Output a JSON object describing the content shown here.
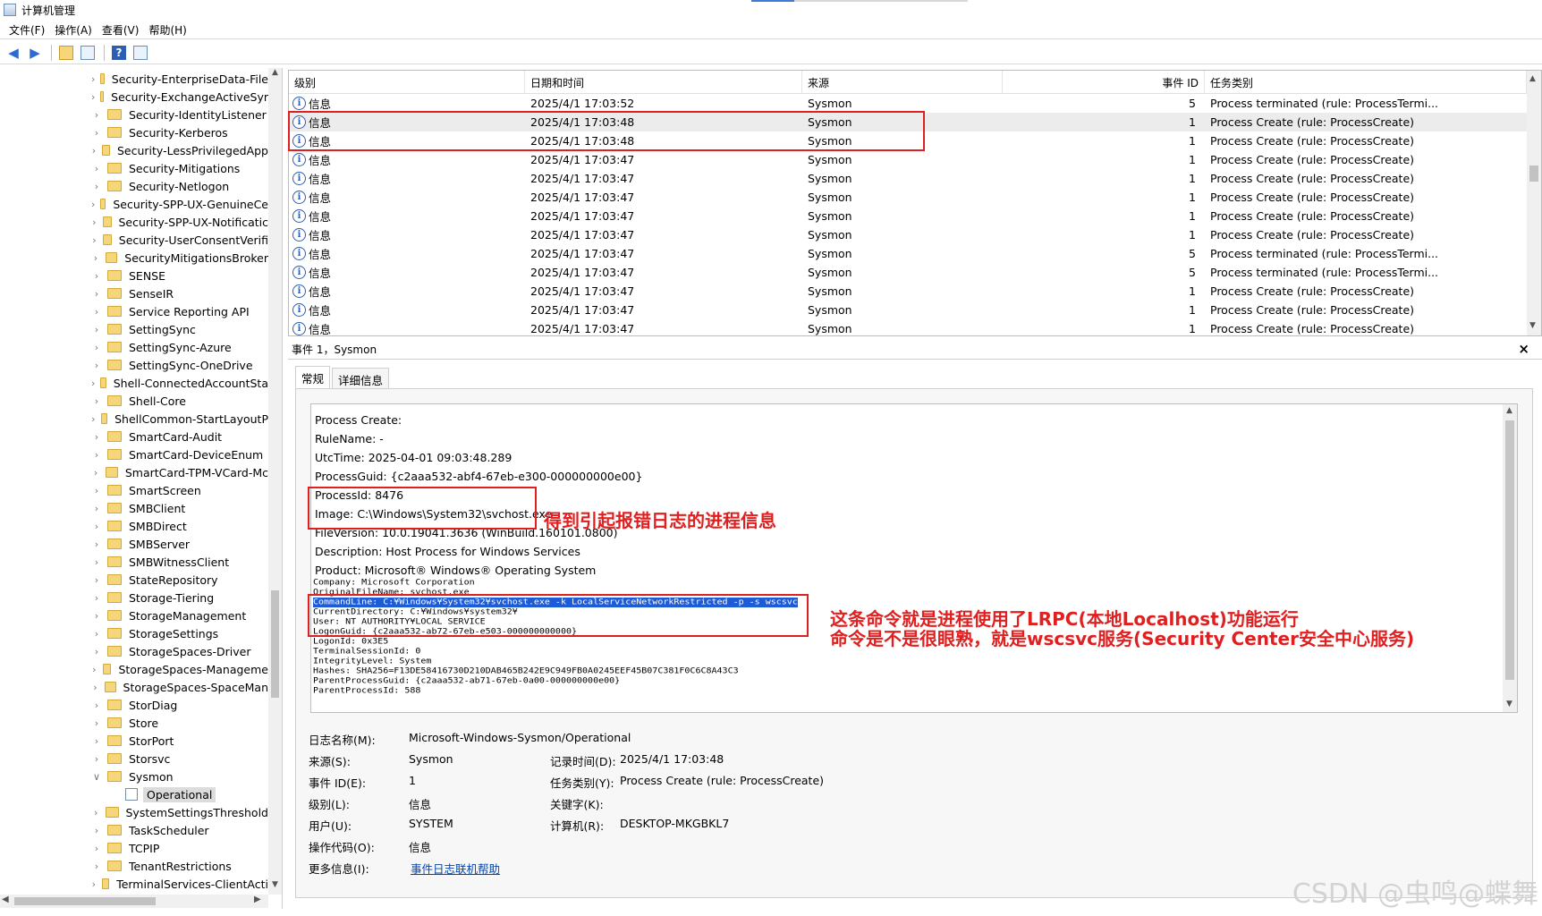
{
  "window": {
    "title": "计算机管理"
  },
  "menu": [
    "文件(F)",
    "操作(A)",
    "查看(V)",
    "帮助(H)"
  ],
  "toolbar": {
    "back_icon": "arrow-left-icon",
    "forward_icon": "arrow-right-icon",
    "help_glyph": "?"
  },
  "tree": {
    "items": [
      "Security-EnterpriseData-File",
      "Security-ExchangeActiveSyr",
      "Security-IdentityListener",
      "Security-Kerberos",
      "Security-LessPrivilegedApp",
      "Security-Mitigations",
      "Security-Netlogon",
      "Security-SPP-UX-GenuineCe",
      "Security-SPP-UX-Notificatic",
      "Security-UserConsentVerifi",
      "SecurityMitigationsBroker",
      "SENSE",
      "SenseIR",
      "Service Reporting API",
      "SettingSync",
      "SettingSync-Azure",
      "SettingSync-OneDrive",
      "Shell-ConnectedAccountSta",
      "Shell-Core",
      "ShellCommon-StartLayoutP",
      "SmartCard-Audit",
      "SmartCard-DeviceEnum",
      "SmartCard-TPM-VCard-Mc",
      "SmartScreen",
      "SMBClient",
      "SMBDirect",
      "SMBServer",
      "SMBWitnessClient",
      "StateRepository",
      "Storage-Tiering",
      "StorageManagement",
      "StorageSettings",
      "StorageSpaces-Driver",
      "StorageSpaces-Manageme",
      "StorageSpaces-SpaceMan",
      "StorDiag",
      "Store",
      "StorPort",
      "Storsvc",
      "Sysmon"
    ],
    "selected_child": "Operational",
    "after_items": [
      "SystemSettingsThreshold",
      "TaskScheduler",
      "TCPIP",
      "TenantRestrictions",
      "TerminalServices-ClientActi"
    ]
  },
  "events": {
    "columns": [
      "级别",
      "日期和时间",
      "来源",
      "事件 ID",
      "任务类别"
    ],
    "rows": [
      {
        "level": "信息",
        "datetime": "2025/4/1 17:03:52",
        "source": "Sysmon",
        "id": "5",
        "task": "Process terminated (rule: ProcessTermi..."
      },
      {
        "level": "信息",
        "datetime": "2025/4/1 17:03:48",
        "source": "Sysmon",
        "id": "1",
        "task": "Process Create (rule: ProcessCreate)"
      },
      {
        "level": "信息",
        "datetime": "2025/4/1 17:03:48",
        "source": "Sysmon",
        "id": "1",
        "task": "Process Create (rule: ProcessCreate)"
      },
      {
        "level": "信息",
        "datetime": "2025/4/1 17:03:47",
        "source": "Sysmon",
        "id": "1",
        "task": "Process Create (rule: ProcessCreate)"
      },
      {
        "level": "信息",
        "datetime": "2025/4/1 17:03:47",
        "source": "Sysmon",
        "id": "1",
        "task": "Process Create (rule: ProcessCreate)"
      },
      {
        "level": "信息",
        "datetime": "2025/4/1 17:03:47",
        "source": "Sysmon",
        "id": "1",
        "task": "Process Create (rule: ProcessCreate)"
      },
      {
        "level": "信息",
        "datetime": "2025/4/1 17:03:47",
        "source": "Sysmon",
        "id": "1",
        "task": "Process Create (rule: ProcessCreate)"
      },
      {
        "level": "信息",
        "datetime": "2025/4/1 17:03:47",
        "source": "Sysmon",
        "id": "1",
        "task": "Process Create (rule: ProcessCreate)"
      },
      {
        "level": "信息",
        "datetime": "2025/4/1 17:03:47",
        "source": "Sysmon",
        "id": "5",
        "task": "Process terminated (rule: ProcessTermi..."
      },
      {
        "level": "信息",
        "datetime": "2025/4/1 17:03:47",
        "source": "Sysmon",
        "id": "5",
        "task": "Process terminated (rule: ProcessTermi..."
      },
      {
        "level": "信息",
        "datetime": "2025/4/1 17:03:47",
        "source": "Sysmon",
        "id": "1",
        "task": "Process Create (rule: ProcessCreate)"
      },
      {
        "level": "信息",
        "datetime": "2025/4/1 17:03:47",
        "source": "Sysmon",
        "id": "1",
        "task": "Process Create (rule: ProcessCreate)"
      },
      {
        "level": "信息",
        "datetime": "2025/4/1 17:03:47",
        "source": "Sysmon",
        "id": "1",
        "task": "Process Create (rule: ProcessCreate)"
      }
    ]
  },
  "detail": {
    "header": "事件 1，Sysmon",
    "close_glyph": "×",
    "tabs": [
      "常规",
      "详细信息"
    ],
    "description_lines": [
      "Process Create:",
      "RuleName: -",
      "UtcTime: 2025-04-01 09:03:48.289",
      "ProcessGuid: {c2aaa532-abf4-67eb-e300-000000000e00}",
      "ProcessId: 8476",
      "Image: C:\\Windows\\System32\\svchost.exe",
      "FileVersion: 10.0.19041.3636 (WinBuild.160101.0800)",
      "Description: Host Process for Windows Services",
      "Product: Microsoft® Windows® Operating System"
    ],
    "mono_lines": [
      "Company: Microsoft Corporation",
      "OriginalFileName: svchost.exe",
      "CommandLine: C:¥Windows¥System32¥svchost.exe -k LocalServiceNetworkRestricted -p -s wscsvc",
      "CurrentDirectory: C:¥Windows¥system32¥",
      "User: NT AUTHORITY¥LOCAL SERVICE",
      "LogonGuid: {c2aaa532-ab72-67eb-e503-000000000000}",
      "LogonId: 0x3E5",
      "TerminalSessionId: 0",
      "IntegrityLevel: System",
      "Hashes: SHA256=F13DE58416730D210DAB465B242E9C949FB0A0245EEF45B07C381F0C6C8A43C3",
      "ParentProcessGuid: {c2aaa532-ab71-67eb-0a00-000000000e00}",
      "ParentProcessId: 588"
    ],
    "props": {
      "log_name_label": "日志名称(M):",
      "log_name": "Microsoft-Windows-Sysmon/Operational",
      "source_label": "来源(S):",
      "source": "Sysmon",
      "logged_label": "记录时间(D):",
      "logged": "2025/4/1 17:03:48",
      "event_id_label": "事件 ID(E):",
      "event_id": "1",
      "task_label": "任务类别(Y):",
      "task": "Process Create (rule: ProcessCreate)",
      "level_label": "级别(L):",
      "level": "信息",
      "keywords_label": "关键字(K):",
      "keywords": "",
      "user_label": "用户(U):",
      "user": "SYSTEM",
      "computer_label": "计算机(R):",
      "computer": "DESKTOP-MKGBKL7",
      "opcode_label": "操作代码(O):",
      "opcode": "信息",
      "more_label": "更多信息(I):",
      "more_link": "事件日志联机帮助"
    }
  },
  "annotations": {
    "note1": "得到引起报错日志的进程信息",
    "note2_line1": "这条命令就是进程使用了LRPC(本地Localhost)功能运行",
    "note2_line2": "命令是不是很眼熟，就是wscsvc服务(Security Center安全中心服务)"
  },
  "watermark": "CSDN @虫鸣@蝶舞",
  "colors": {
    "annotation": "#e02020",
    "selection": "#1e5bd6",
    "link": "#0645ad"
  }
}
